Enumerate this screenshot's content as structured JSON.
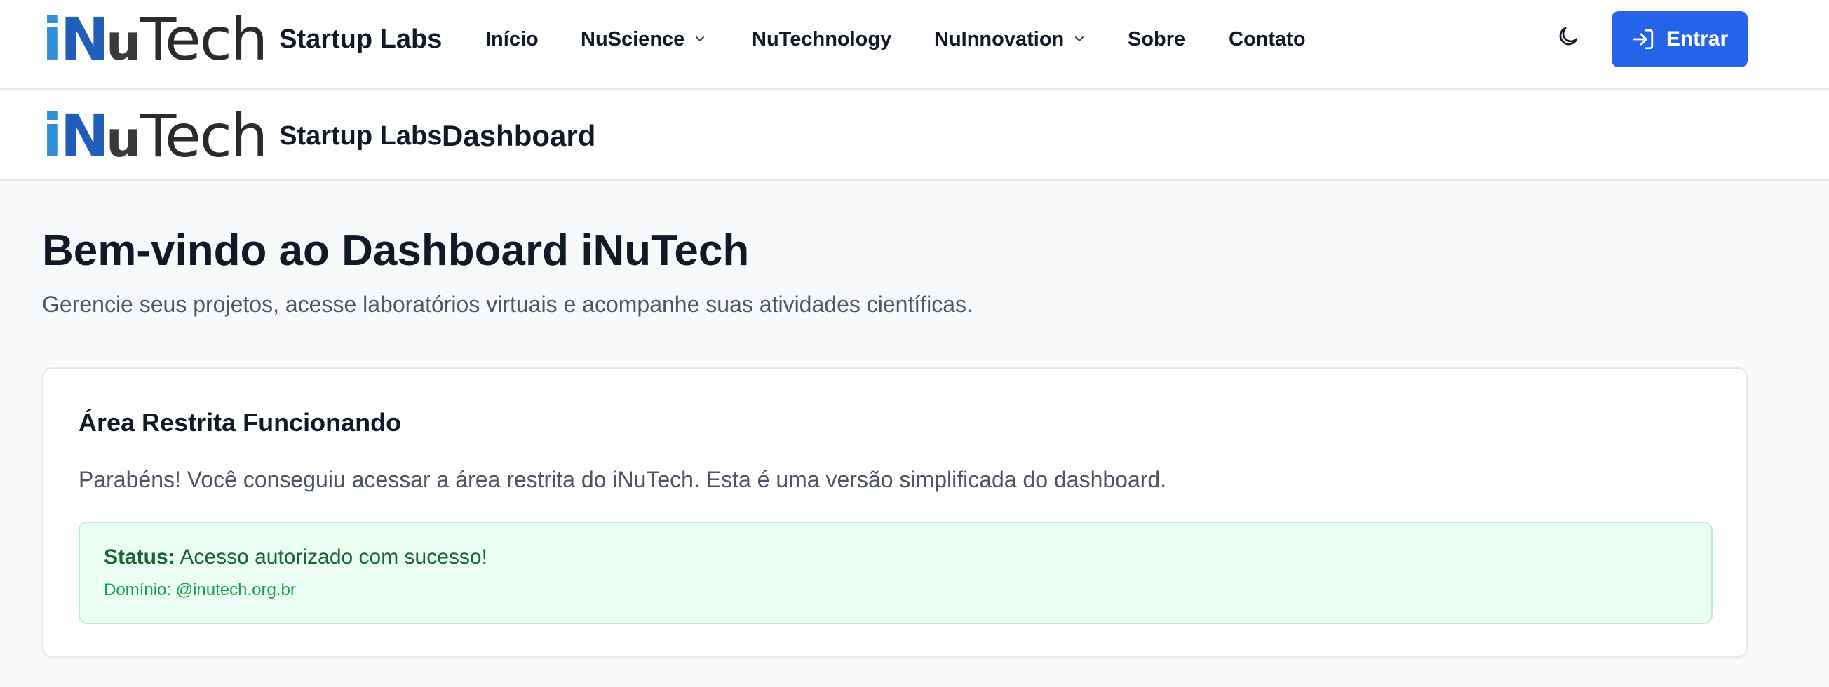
{
  "header": {
    "logo_i": "i",
    "logo_n": "N",
    "logo_u": "u",
    "logo_tech": "Tech",
    "brand_label": "Startup Labs",
    "nav": [
      {
        "label": "Início"
      },
      {
        "label": "NuScience",
        "has_dropdown": true
      },
      {
        "label": "NuTechnology"
      },
      {
        "label": "NuInnovation",
        "has_dropdown": true
      },
      {
        "label": "Sobre"
      },
      {
        "label": "Contato"
      }
    ],
    "theme_icon": "moon-icon",
    "login_icon": "log-in-icon",
    "login_label": "Entrar"
  },
  "subheader": {
    "brand_label": "Startup Labs",
    "page_title": "Dashboard"
  },
  "main": {
    "title": "Bem-vindo ao Dashboard iNuTech",
    "subtitle": "Gerencie seus projetos, acesse laboratórios virtuais e acompanhe suas atividades científicas.",
    "card": {
      "title": "Área Restrita Funcionando",
      "text": "Parabéns! Você conseguiu acessar a área restrita do iNuTech. Esta é uma versão simplificada do dashboard.",
      "status_label": "Status:",
      "status_value": "Acesso autorizado com sucesso!",
      "domain_text": "Domínio: @inutech.org.br"
    }
  },
  "colors": {
    "primary": "#2563eb",
    "success_bg": "#ecfdf3",
    "success_text": "#166534",
    "logo_blue_light": "#2f8fd8",
    "logo_blue_dark": "#1f5fb8"
  }
}
